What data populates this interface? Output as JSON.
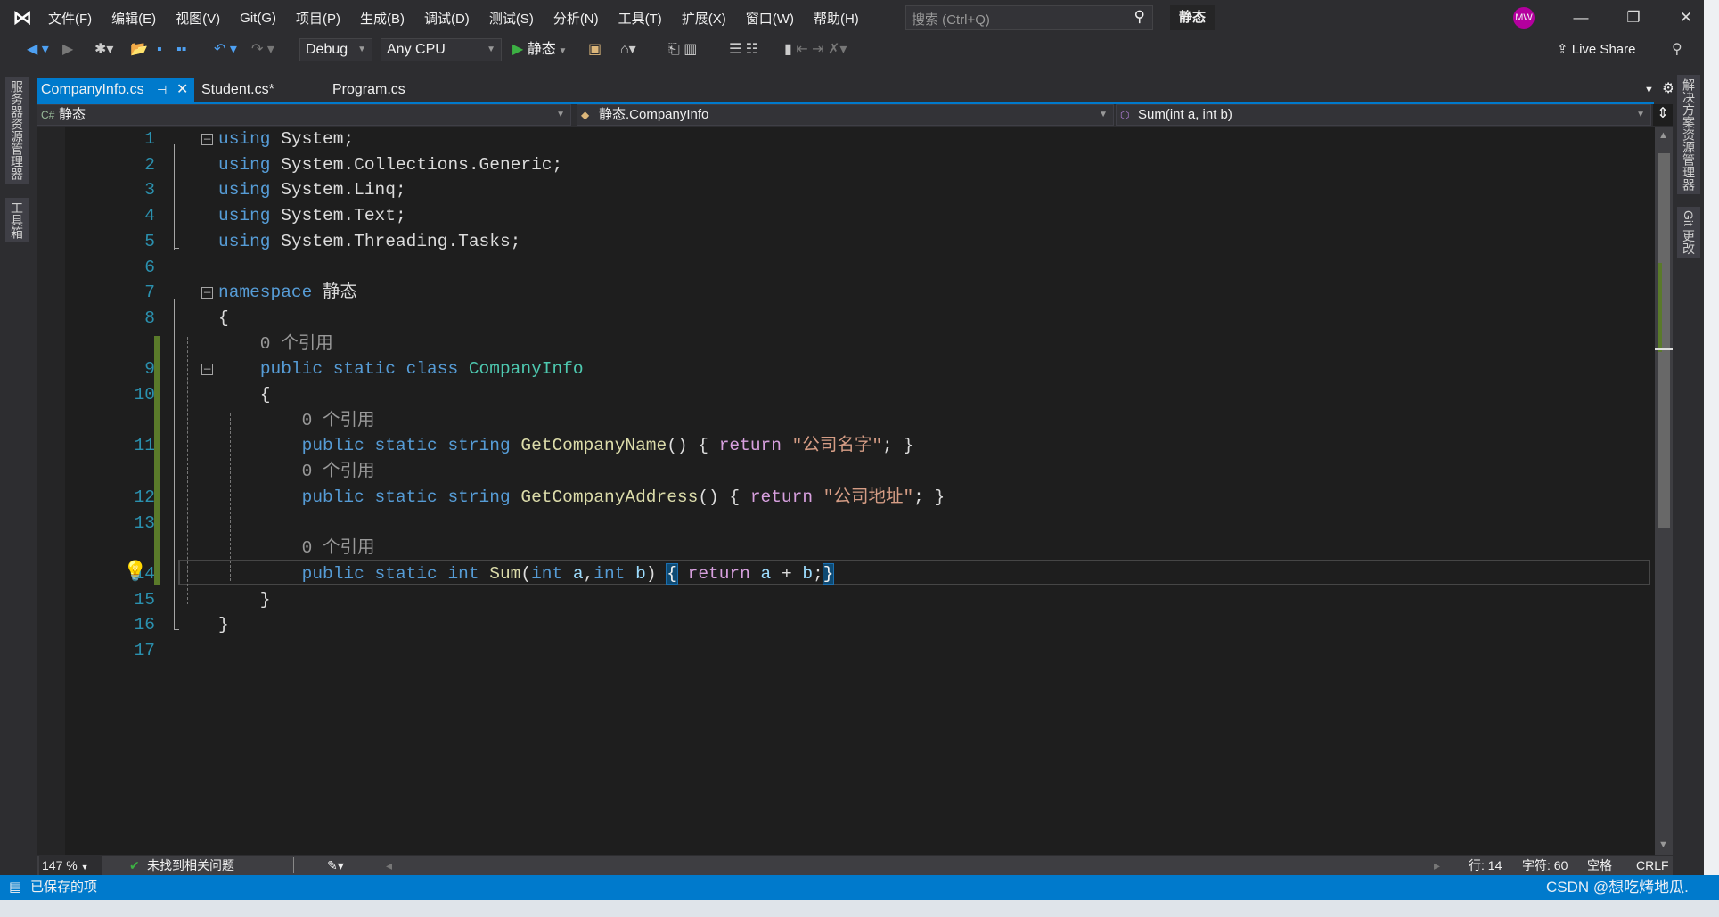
{
  "menu": {
    "items": [
      "文件(F)",
      "编辑(E)",
      "视图(V)",
      "Git(G)",
      "项目(P)",
      "生成(B)",
      "调试(D)",
      "测试(S)",
      "分析(N)",
      "工具(T)",
      "扩展(X)",
      "窗口(W)",
      "帮助(H)"
    ],
    "search_placeholder": "搜索 (Ctrl+Q)",
    "solution_name": "静态",
    "avatar": "MW"
  },
  "toolbar": {
    "config": "Debug",
    "platform": "Any CPU",
    "start_label": "静态",
    "live_share": "Live Share"
  },
  "tabs": [
    {
      "label": "CompanyInfo.cs",
      "active": true
    },
    {
      "label": "Student.cs*"
    },
    {
      "label": "Program.cs"
    }
  ],
  "navbar": {
    "project": "静态",
    "type": "静态.CompanyInfo",
    "member": "Sum(int a, int b)"
  },
  "side_left": [
    "服务器资源管理器",
    "工具箱"
  ],
  "side_right": [
    "解决方案资源管理器",
    "Git 更改"
  ],
  "colors": {
    "accent": "#007acc",
    "keyword": "#569cd6",
    "type": "#4ec9b0",
    "method": "#dcdcaa",
    "string": "#d69d85",
    "control": "#d8a0df",
    "line_number": "#2b91af"
  },
  "code": [
    {
      "n": "1",
      "fold": true,
      "tokens": [
        [
          "kw",
          "using"
        ],
        [
          "tx",
          " System;"
        ]
      ]
    },
    {
      "n": "2",
      "tokens": [
        [
          "kw",
          "using"
        ],
        [
          "tx",
          " System.Collections.Generic;"
        ]
      ]
    },
    {
      "n": "3",
      "tokens": [
        [
          "kw",
          "using"
        ],
        [
          "tx",
          " System.Linq;"
        ]
      ]
    },
    {
      "n": "4",
      "tokens": [
        [
          "kw",
          "using"
        ],
        [
          "tx",
          " System.Text;"
        ]
      ]
    },
    {
      "n": "5",
      "tokens": [
        [
          "kw",
          "using"
        ],
        [
          "tx",
          " System.Threading.Tasks;"
        ]
      ]
    },
    {
      "n": "6",
      "tokens": []
    },
    {
      "n": "7",
      "fold": true,
      "tokens": [
        [
          "kw",
          "namespace"
        ],
        [
          "tx",
          " 静态"
        ]
      ]
    },
    {
      "n": "8",
      "tokens": [
        [
          "tx",
          "{"
        ]
      ]
    },
    {
      "n": "",
      "tokens": [
        [
          "lens",
          "    0 个引用"
        ]
      ]
    },
    {
      "n": "9",
      "fold": true,
      "tokens": [
        [
          "tx",
          "    "
        ],
        [
          "kw",
          "public static class"
        ],
        [
          "tx",
          " "
        ],
        [
          "ty",
          "CompanyInfo"
        ]
      ]
    },
    {
      "n": "10",
      "tokens": [
        [
          "tx",
          "    {"
        ]
      ]
    },
    {
      "n": "",
      "tokens": [
        [
          "lens",
          "        0 个引用"
        ]
      ]
    },
    {
      "n": "11",
      "tokens": [
        [
          "tx",
          "        "
        ],
        [
          "kw",
          "public static string"
        ],
        [
          "tx",
          " "
        ],
        [
          "fn",
          "GetCompanyName"
        ],
        [
          "tx",
          "() { "
        ],
        [
          "ctl",
          "return"
        ],
        [
          "tx",
          " "
        ],
        [
          "st",
          "\"公司名字\""
        ],
        [
          "tx",
          "; }"
        ]
      ]
    },
    {
      "n": "",
      "tokens": [
        [
          "lens",
          "        0 个引用"
        ]
      ]
    },
    {
      "n": "12",
      "tokens": [
        [
          "tx",
          "        "
        ],
        [
          "kw",
          "public static string"
        ],
        [
          "tx",
          " "
        ],
        [
          "fn",
          "GetCompanyAddress"
        ],
        [
          "tx",
          "() { "
        ],
        [
          "ctl",
          "return"
        ],
        [
          "tx",
          " "
        ],
        [
          "st",
          "\"公司地址\""
        ],
        [
          "tx",
          "; }"
        ]
      ]
    },
    {
      "n": "13",
      "tokens": []
    },
    {
      "n": "",
      "tokens": [
        [
          "lens",
          "        0 个引用"
        ]
      ]
    },
    {
      "n": "14",
      "tokens": [
        [
          "tx",
          "        "
        ],
        [
          "kw",
          "public static int"
        ],
        [
          "tx",
          " "
        ],
        [
          "fn",
          "Sum"
        ],
        [
          "tx",
          "("
        ],
        [
          "kw",
          "int"
        ],
        [
          "pa",
          " a"
        ],
        [
          "tx",
          ","
        ],
        [
          "kw",
          "int"
        ],
        [
          "pa",
          " b"
        ],
        [
          "tx",
          ") "
        ],
        [
          "bm",
          "{"
        ],
        [
          "tx",
          " "
        ],
        [
          "ctl",
          "return"
        ],
        [
          "pa",
          " a"
        ],
        [
          "tx",
          " + "
        ],
        [
          "pa",
          "b"
        ],
        [
          "tx",
          ";"
        ],
        [
          "bm",
          "}"
        ]
      ]
    },
    {
      "n": "15",
      "tokens": [
        [
          "tx",
          "    }"
        ]
      ]
    },
    {
      "n": "16",
      "tokens": [
        [
          "tx",
          "}"
        ]
      ]
    },
    {
      "n": "17",
      "tokens": []
    }
  ],
  "statusbar": {
    "zoom": "147 %",
    "issues": "未找到相关问题",
    "line": "行: 14",
    "char": "字符: 60",
    "indent": "空格",
    "eol": "CRLF"
  },
  "bottom": {
    "message": "已保存的项",
    "watermark": "CSDN @想吃烤地瓜."
  }
}
